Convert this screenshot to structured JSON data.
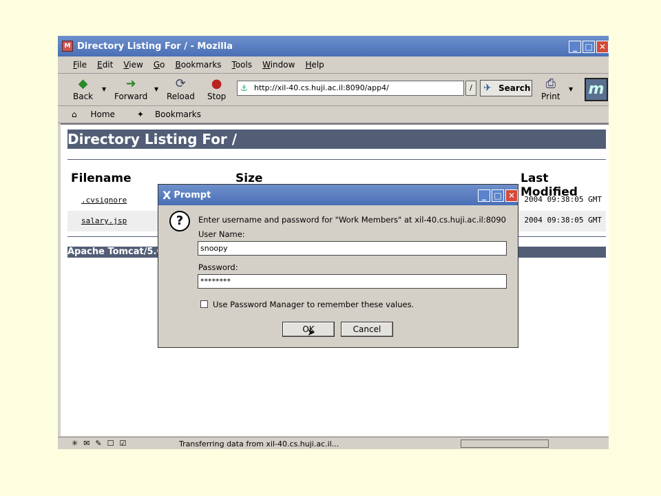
{
  "browser": {
    "window_title": "Directory Listing For / - Mozilla",
    "menu": [
      "File",
      "Edit",
      "View",
      "Go",
      "Bookmarks",
      "Tools",
      "Window",
      "Help"
    ],
    "toolbar": {
      "back": "Back",
      "forward": "Forward",
      "reload": "Reload",
      "stop": "Stop",
      "url": "http://xil-40.cs.huji.ac.il:8090/app4/",
      "url_drop": "/",
      "search": "Search",
      "print": "Print"
    },
    "personal_toolbar": {
      "home": "Home",
      "bookmarks": "Bookmarks"
    },
    "status_text": "Transferring data from xil-40.cs.huji.ac.il..."
  },
  "page": {
    "heading": "Directory Listing For /",
    "columns": {
      "filename": "Filename",
      "size": "Size",
      "modified": "Last Modified"
    },
    "rows": [
      {
        "name": ".cvsignore",
        "modified": "2004 09:38:05 GMT"
      },
      {
        "name": "salary.jsp",
        "modified": "2004 09:38:05 GMT"
      }
    ],
    "footer": "Apache Tomcat/5.0"
  },
  "dialog": {
    "title": "Prompt",
    "message": "Enter username and password for \"Work Members\" at xil-40.cs.huji.ac.il:8090",
    "user_label": "User Name:",
    "user_value": "snoopy",
    "password_label": "Password:",
    "password_value": "********",
    "remember_label": "Use Password Manager to remember these values.",
    "ok": "OK",
    "cancel": "Cancel"
  },
  "colors": {
    "titlebar": "#4a6fb5",
    "tomcat_bar": "#525d76",
    "desktop": "#fdfde0"
  }
}
